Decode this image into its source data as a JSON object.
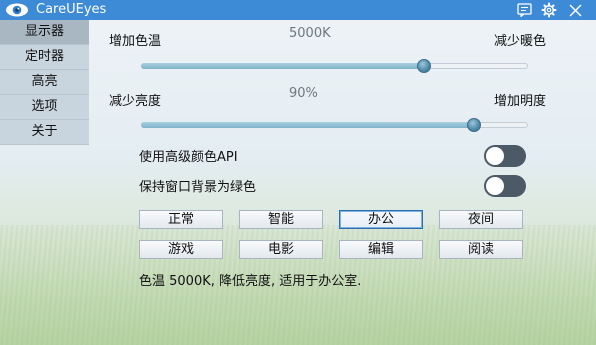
{
  "titlebar": {
    "app_title": "CareUEyes",
    "icons": [
      "eye-logo-icon",
      "feedback-icon",
      "gear-icon",
      "close-icon"
    ]
  },
  "sidebar": {
    "items": [
      {
        "label": "显示器",
        "active": true
      },
      {
        "label": "定时器",
        "active": false
      },
      {
        "label": "高亮",
        "active": false
      },
      {
        "label": "选项",
        "active": false
      },
      {
        "label": "关于",
        "active": false
      }
    ]
  },
  "color_temp": {
    "left_label": "增加色温",
    "right_label": "减少暖色",
    "value": "5000K",
    "level": 0.73
  },
  "brightness": {
    "left_label": "减少亮度",
    "right_label": "增加明度",
    "value": "90%",
    "level": 0.86
  },
  "toggles": [
    {
      "label": "使用高级颜色API",
      "on": false
    },
    {
      "label": "保持窗口背景为绿色",
      "on": false
    }
  ],
  "presets": {
    "row1": [
      "正常",
      "智能",
      "办公",
      "夜间"
    ],
    "row2": [
      "游戏",
      "电影",
      "编辑",
      "阅读"
    ],
    "selected": "办公"
  },
  "status_text": "色温 5000K, 降低亮度, 适用于办公室.",
  "colors": {
    "titlebar": "#3d8ad6",
    "sidebar": "#c9d5de",
    "toggle_off": "#4c5966",
    "selected_border": "#2a6fb0"
  }
}
